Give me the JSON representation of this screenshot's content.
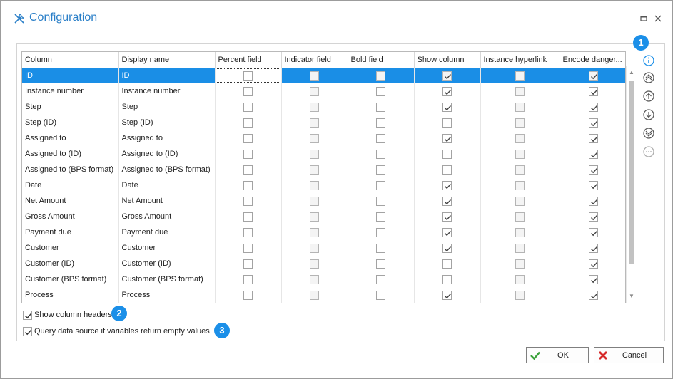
{
  "window": {
    "title": "Configuration"
  },
  "grid": {
    "columns": [
      "Column",
      "Display name",
      "Percent field",
      "Indicator field",
      "Bold field",
      "Show column",
      "Instance hyperlink",
      "Encode danger..."
    ],
    "rows": [
      {
        "column": "ID",
        "display": "ID",
        "percent": false,
        "indicator": false,
        "bold": false,
        "show": true,
        "hyperlink": false,
        "encode": true,
        "selected": true
      },
      {
        "column": "Instance number",
        "display": "Instance number",
        "percent": false,
        "indicator": false,
        "bold": false,
        "show": true,
        "hyperlink": false,
        "encode": true
      },
      {
        "column": "Step",
        "display": "Step",
        "percent": false,
        "indicator": false,
        "bold": false,
        "show": true,
        "hyperlink": false,
        "encode": true
      },
      {
        "column": "Step (ID)",
        "display": "Step (ID)",
        "percent": false,
        "indicator": false,
        "bold": false,
        "show": false,
        "hyperlink": false,
        "encode": true
      },
      {
        "column": "Assigned to",
        "display": "Assigned to",
        "percent": false,
        "indicator": false,
        "bold": false,
        "show": true,
        "hyperlink": false,
        "encode": true
      },
      {
        "column": "Assigned to (ID)",
        "display": "Assigned to (ID)",
        "percent": false,
        "indicator": false,
        "bold": false,
        "show": false,
        "hyperlink": false,
        "encode": true
      },
      {
        "column": "Assigned to (BPS format)",
        "display": "Assigned to (BPS format)",
        "percent": false,
        "indicator": false,
        "bold": false,
        "show": false,
        "hyperlink": false,
        "encode": true
      },
      {
        "column": "Date",
        "display": "Date",
        "percent": false,
        "indicator": false,
        "bold": false,
        "show": true,
        "hyperlink": false,
        "encode": true
      },
      {
        "column": "Net Amount",
        "display": "Net Amount",
        "percent": false,
        "indicator": false,
        "bold": false,
        "show": true,
        "hyperlink": false,
        "encode": true
      },
      {
        "column": "Gross Amount",
        "display": "Gross Amount",
        "percent": false,
        "indicator": false,
        "bold": false,
        "show": true,
        "hyperlink": false,
        "encode": true
      },
      {
        "column": "Payment due",
        "display": "Payment due",
        "percent": false,
        "indicator": false,
        "bold": false,
        "show": true,
        "hyperlink": false,
        "encode": true
      },
      {
        "column": "Customer",
        "display": "Customer",
        "percent": false,
        "indicator": false,
        "bold": false,
        "show": true,
        "hyperlink": false,
        "encode": true
      },
      {
        "column": "Customer (ID)",
        "display": "Customer (ID)",
        "percent": false,
        "indicator": false,
        "bold": false,
        "show": false,
        "hyperlink": false,
        "encode": true
      },
      {
        "column": "Customer (BPS format)",
        "display": "Customer (BPS format)",
        "percent": false,
        "indicator": false,
        "bold": false,
        "show": false,
        "hyperlink": false,
        "encode": true
      },
      {
        "column": "Process",
        "display": "Process",
        "percent": false,
        "indicator": false,
        "bold": false,
        "show": true,
        "hyperlink": false,
        "encode": true
      }
    ]
  },
  "side_buttons": [
    "info-icon",
    "move-top-icon",
    "move-up-icon",
    "move-down-icon",
    "move-bottom-icon",
    "more-icon"
  ],
  "options": {
    "show_headers": {
      "label": "Show column headers",
      "checked": true
    },
    "query_source": {
      "label": "Query data source if variables return empty values",
      "checked": true
    }
  },
  "badges": [
    "1",
    "2",
    "3"
  ],
  "buttons": {
    "ok": "OK",
    "cancel": "Cancel"
  },
  "colors": {
    "accent": "#1b8fe8",
    "selection": "#1a8ee6",
    "title": "#2a7fc8",
    "ok_green": "#3aa23a",
    "cancel_red": "#d62828"
  }
}
